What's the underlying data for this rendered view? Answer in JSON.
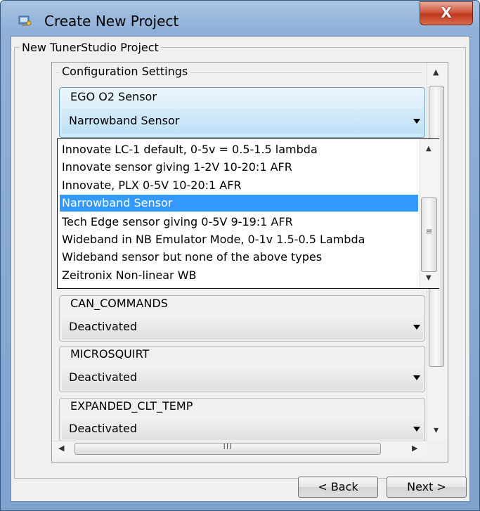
{
  "window": {
    "title": "Create New Project",
    "close_label": "X"
  },
  "project_group": {
    "label": "New TunerStudio Project"
  },
  "config": {
    "label": "Configuration Settings"
  },
  "ego": {
    "label": "EGO O2 Sensor",
    "value": "Narrowband Sensor"
  },
  "dropdown": {
    "options": [
      "Innovate LC-1 default, 0-5v = 0.5-1.5 lambda",
      "Innovate sensor giving 1-2V 10-20:1 AFR",
      "Innovate, PLX 0-5V 10-20:1 AFR",
      "Narrowband Sensor",
      "Tech Edge sensor giving 0-5V 9-19:1 AFR",
      "Wideband in NB Emulator Mode, 0-1v 1.5-0.5 Lambda",
      "Wideband sensor but none of the above types",
      "Zeitronix Non-linear WB"
    ],
    "selected": "Narrowband Sensor"
  },
  "settings": [
    {
      "label": "CAN_COMMANDS",
      "value": "Deactivated"
    },
    {
      "label": "MICROSQUIRT",
      "value": "Deactivated"
    },
    {
      "label": "EXPANDED_CLT_TEMP",
      "value": "Deactivated"
    }
  ],
  "scroll": {
    "grip": "III",
    "dd_grip": "≡"
  },
  "buttons": {
    "back": "< Back",
    "next": "Next >"
  },
  "icons": {
    "app": "app-icon",
    "close": "close-icon",
    "dropdown": "chevron-down-icon"
  },
  "colors": {
    "selection": "#3399ff",
    "title_bar": "#8fb0d8",
    "close_button": "#c0391f"
  }
}
